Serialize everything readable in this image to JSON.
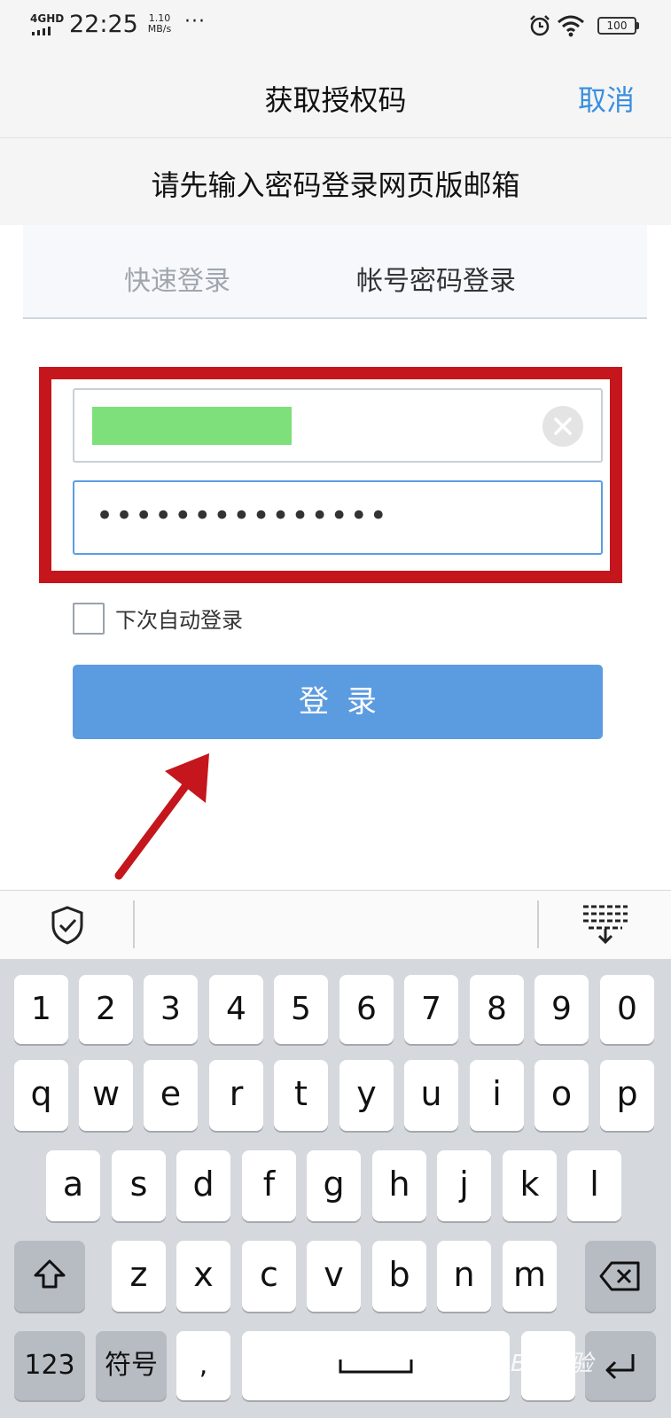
{
  "status_bar": {
    "network": "4GHD",
    "time": "22:25",
    "speed_value": "1.10",
    "speed_unit": "MB/s",
    "more": "···",
    "battery": "100"
  },
  "nav": {
    "title": "获取授权码",
    "cancel": "取消"
  },
  "prompt": "请先输入密码登录网页版邮箱",
  "tabs": {
    "quick": "快速登录",
    "password": "帐号密码登录"
  },
  "form": {
    "password_mask": "•••••••••••••••",
    "auto_login": "下次自动登录",
    "login_button": "登录"
  },
  "keyboard": {
    "numbers": [
      "1",
      "2",
      "3",
      "4",
      "5",
      "6",
      "7",
      "8",
      "9",
      "0"
    ],
    "row1": [
      "q",
      "w",
      "e",
      "r",
      "t",
      "y",
      "u",
      "i",
      "o",
      "p"
    ],
    "row2": [
      "a",
      "s",
      "d",
      "f",
      "g",
      "h",
      "j",
      "k",
      "l"
    ],
    "row3": [
      "z",
      "x",
      "c",
      "v",
      "b",
      "n",
      "m"
    ],
    "mode_key": "123",
    "symbols_key": "符号",
    "comma_key": ",",
    "shift_icon": "shift-icon",
    "backspace_icon": "backspace-icon",
    "space_icon": "space-icon",
    "enter_icon": "enter-icon"
  },
  "colors": {
    "accent": "#3a8fe0",
    "login_button": "#5b9be0",
    "highlight": "#c4161c",
    "redaction": "#7ee07a"
  },
  "watermark": "Bai经验"
}
